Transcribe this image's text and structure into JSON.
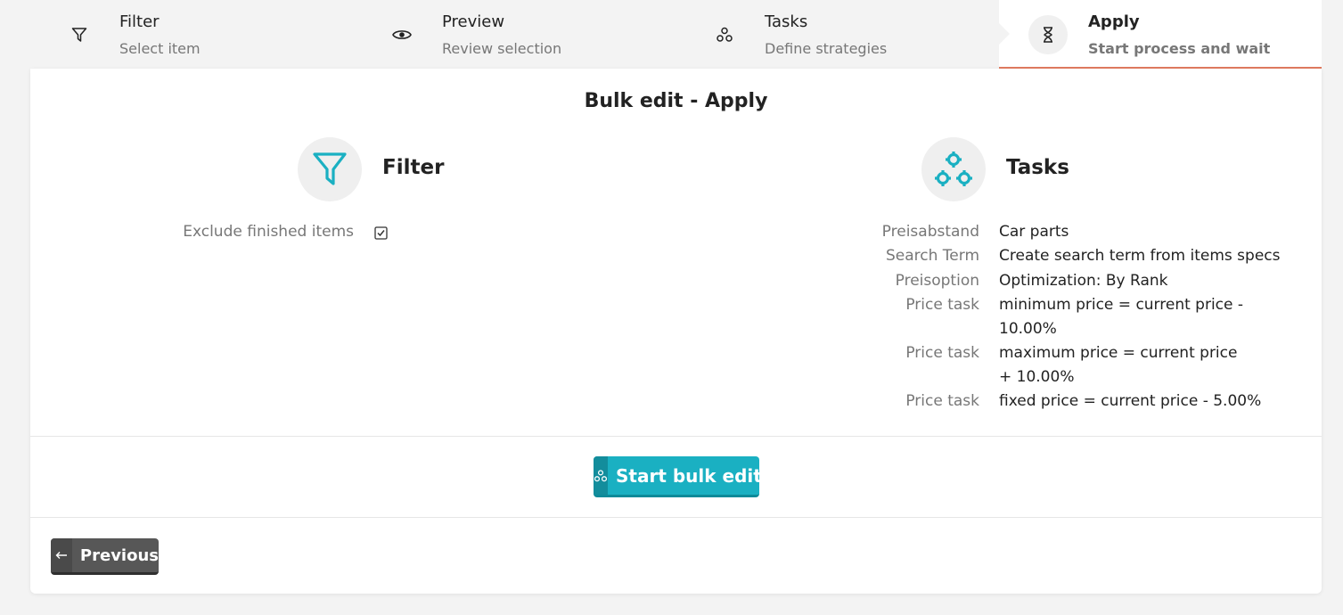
{
  "steps": [
    {
      "title": "Filter",
      "subtitle": "Select item",
      "icon": "filter-icon"
    },
    {
      "title": "Preview",
      "subtitle": "Review selection",
      "icon": "eye-icon"
    },
    {
      "title": "Tasks",
      "subtitle": "Define strategies",
      "icon": "gears-icon"
    },
    {
      "title": "Apply",
      "subtitle": "Start process and wait",
      "icon": "hourglass-icon",
      "active": true
    }
  ],
  "card": {
    "title": "Bulk edit - Apply",
    "filter_section": {
      "title": "Filter",
      "items": [
        {
          "label": "Exclude finished items",
          "checked": true
        }
      ]
    },
    "tasks_section": {
      "title": "Tasks",
      "items": [
        {
          "label": "Preisabstand",
          "value": "Car parts"
        },
        {
          "label": "Search Term",
          "value": "Create search term from items specs"
        },
        {
          "label": "Preisoption",
          "value": "Optimization: By Rank"
        },
        {
          "label": "Price task",
          "value": "minimum price = current price - 10.00%"
        },
        {
          "label": "Price task",
          "value": "maximum price = current price + 10.00%"
        },
        {
          "label": "Price task",
          "value": "fixed price = current price - 5.00%"
        }
      ]
    },
    "start_button_label": "Start bulk edit",
    "previous_button_label": "Previous"
  },
  "colors": {
    "accent": "#1ab0c2",
    "active_step_underline": "#e07a5f",
    "secondary_button": "#575757"
  }
}
